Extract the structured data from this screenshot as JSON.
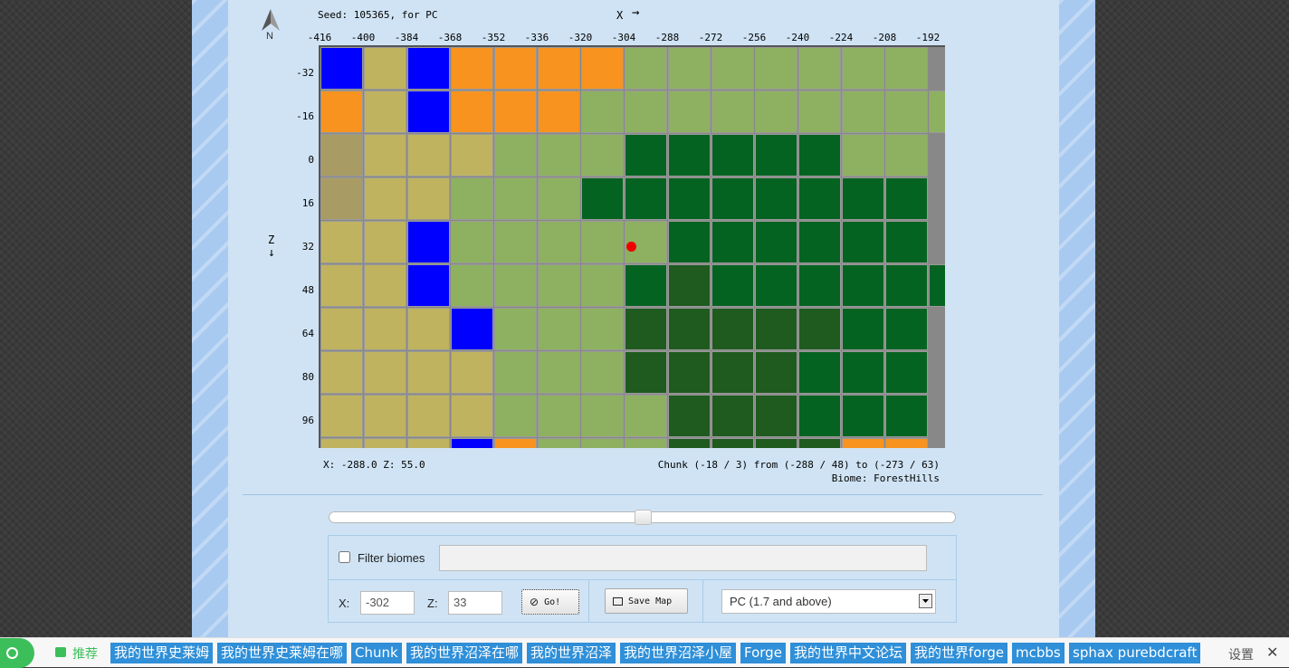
{
  "page": {
    "seed_text": "Seed: 105365, for PC",
    "x_axis_label": "X",
    "z_axis_label": "Z",
    "compass_label": "N",
    "arrow_right": "→",
    "arrow_down": "↓"
  },
  "map": {
    "x_ticks": [
      "-416",
      "-400",
      "-384",
      "-368",
      "-352",
      "-336",
      "-320",
      "-304",
      "-288",
      "-272",
      "-256",
      "-240",
      "-224",
      "-208",
      "-192"
    ],
    "z_ticks": [
      "-32",
      "-16",
      "0",
      "16",
      "32",
      "48",
      "64",
      "80",
      "96"
    ],
    "biome_colors": {
      "o": "#f7931e",
      "b": "#0000ff",
      "t": "#bfb35f",
      "a": "#a89b63",
      "g": "#8db160",
      "f": "#056321",
      "d": "#1f5a1f"
    },
    "grid": [
      "btbooooggggggg",
      "otboooggggggggg",
      "atttgggfffffgg",
      "attgggffffffff",
      "ttbgggggffffff",
      "ttbggggfdffffff",
      "tttbgggdddddff",
      "ttttgggddddfff",
      "ttttggggdddfff",
      "tttbogggddddoo"
    ],
    "marker": "red-dot"
  },
  "info": {
    "coords": "X: -288.0   Z: 55.0",
    "chunk": "Chunk (-18 / 3) from (-288 / 48) to (-273 / 63)",
    "biome": "Biome: ForestHills"
  },
  "controls": {
    "filter_label": "Filter biomes",
    "filter_checked": false,
    "filter_value": "",
    "x_label": "X:",
    "x_value": "-302",
    "z_label": "Z:",
    "z_value": "33",
    "go_label": "Go!",
    "save_label": "Save Map",
    "version_value": "PC (1.7 and above)",
    "slider_position": 0.5
  },
  "bottom_bar": {
    "recommend_label": "推荐",
    "tags": [
      "我的世界史莱姆",
      "我的世界史莱姆在哪",
      "Chunk",
      "我的世界沼泽在哪",
      "我的世界沼泽",
      "我的世界沼泽小屋",
      "Forge",
      "我的世界中文论坛",
      "我的世界forge",
      "mcbbs",
      "sphax purebdcraft"
    ],
    "settings_label": "设置",
    "close_label": "✕"
  }
}
